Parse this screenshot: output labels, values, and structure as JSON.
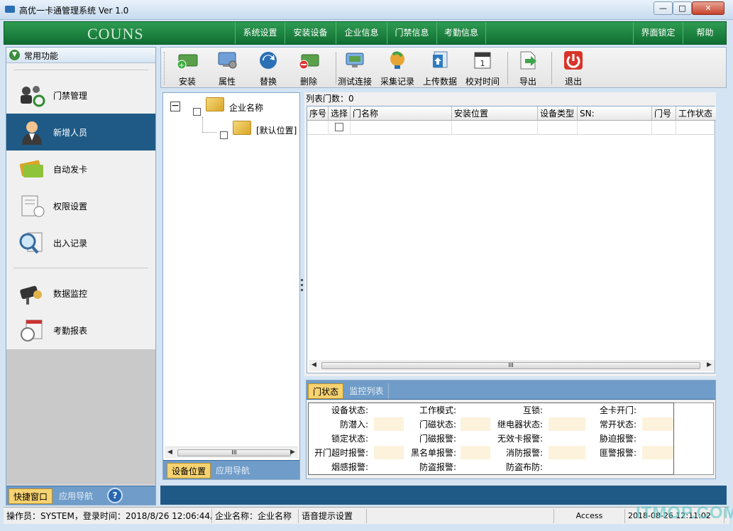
{
  "window": {
    "title": "高优一卡通管理系统  Ver 1.0",
    "min_glyph": "—",
    "max_glyph": "□",
    "close_glyph": "✕"
  },
  "menubar": {
    "brand": "COUNS",
    "items": [
      "系统设置",
      "安装设备",
      "企业信息",
      "门禁信息",
      "考勤信息"
    ],
    "right_items": [
      "界面锁定",
      "帮助"
    ]
  },
  "sidebar": {
    "header": "常用功能",
    "items": [
      {
        "label": "门禁管理",
        "icon": "people-gear-icon",
        "active": false
      },
      {
        "label": "新增人员",
        "icon": "person-icon",
        "active": true
      },
      {
        "label": "自动发卡",
        "icon": "cards-icon",
        "active": false
      },
      {
        "label": "权限设置",
        "icon": "document-clock-icon",
        "active": false
      },
      {
        "label": "出入记录",
        "icon": "magnifier-document-icon",
        "active": false
      },
      {
        "label": "数据监控",
        "icon": "camera-icon",
        "active": false
      },
      {
        "label": "考勤报表",
        "icon": "calendar-clock-icon",
        "active": false
      }
    ],
    "tabs": [
      "快捷窗口",
      "应用导航"
    ],
    "help": "?"
  },
  "toolbar": {
    "buttons": [
      {
        "label": "安装",
        "icon": "install-icon"
      },
      {
        "label": "属性",
        "icon": "properties-icon"
      },
      {
        "label": "替换",
        "icon": "replace-icon"
      },
      {
        "label": "删除",
        "icon": "delete-icon"
      },
      {
        "label": "测试连接",
        "icon": "test-connection-icon"
      },
      {
        "label": "采集记录",
        "icon": "collect-records-icon"
      },
      {
        "label": "上传数据",
        "icon": "upload-icon"
      },
      {
        "label": "校对时间",
        "icon": "calendar-icon"
      },
      {
        "label": "导出",
        "icon": "export-icon"
      },
      {
        "label": "退出",
        "icon": "power-icon"
      }
    ]
  },
  "tree": {
    "root": "企业名称",
    "child": "[默认位置]",
    "tabs": [
      "设备位置",
      "应用导航"
    ],
    "scroll_thumb": "III"
  },
  "list": {
    "count_label": "列表门数：0",
    "columns": [
      "序号",
      "选择",
      "门名称",
      "安装位置",
      "设备类型",
      "SN:",
      "门号",
      "工作状态"
    ],
    "scroll_thumb": "III"
  },
  "status_panel": {
    "tabs": [
      "门状态",
      "监控列表"
    ],
    "fields": [
      [
        "设备状态:",
        "工作模式:",
        "互锁:",
        "全卡开门:"
      ],
      [
        "防潜入:",
        "门磁状态:",
        "继电器状态:",
        "常开状态:"
      ],
      [
        "锁定状态:",
        "门磁报警:",
        "无效卡报警:",
        "胁迫报警:"
      ],
      [
        "开门超时报警:",
        "黑名单报警:",
        "消防报警:",
        "匪警报警:"
      ],
      [
        "烟感报警:",
        "防盗报警:",
        "防盗布防:",
        ""
      ]
    ]
  },
  "statusbar": {
    "operator": "操作员：SYSTEM，登录时间：2018/8/26 12:06:44。",
    "company": "企业名称：企业名称",
    "voice": "语音提示设置",
    "db": "Access",
    "datetime": "2018-08-26 12:11:02"
  },
  "watermark": "ITMOP.COM",
  "colors": {
    "menubar": "#17823f",
    "active_item": "#1f5a86",
    "tab_active": "#f6d271",
    "tab_strip": "#6f9cc8"
  }
}
